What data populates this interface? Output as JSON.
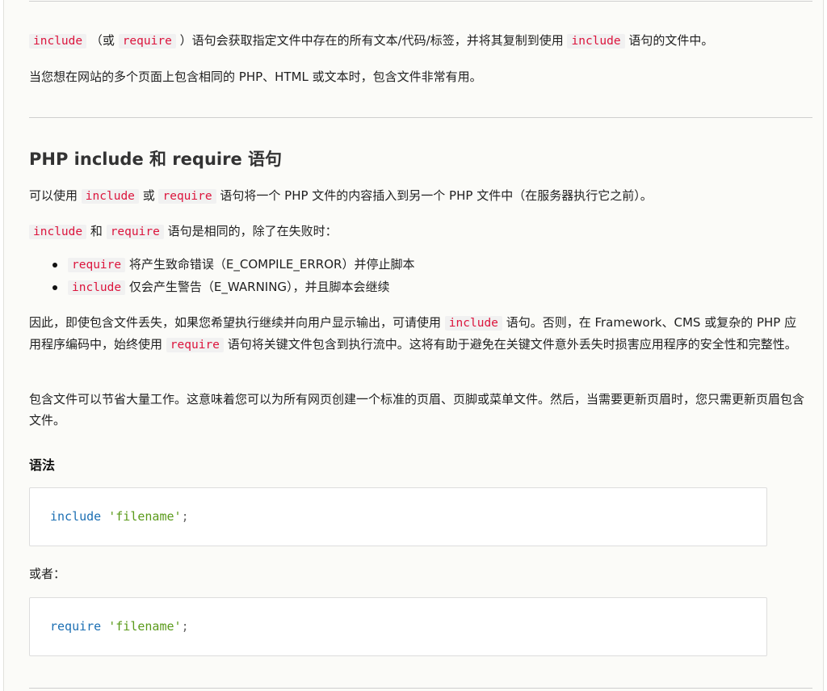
{
  "intro": {
    "p1": {
      "kw1": "include",
      "t1": "（或",
      "kw2": "require",
      "t2": "）语句会获取指定文件中存在的所有文本/代码/标签，并将其复制到使用",
      "kw3": "include",
      "t3": "语句的文件中。"
    },
    "p2": "当您想在网站的多个页面上包含相同的 PHP、HTML 或文本时，包含文件非常有用。"
  },
  "section": {
    "heading": "PHP include 和 require 语句",
    "p1": {
      "t1": "可以使用",
      "kw1": "include",
      "t2": "或",
      "kw2": "require",
      "t3": "语句将一个 PHP 文件的内容插入到另一个 PHP 文件中（在服务器执行它之前）。"
    },
    "p2": {
      "kw1": "include",
      "t1": "和",
      "kw2": "require",
      "t2": "语句是相同的，除了在失败时："
    },
    "bullets": [
      {
        "kw": "require",
        "text": "将产生致命错误（E_COMPILE_ERROR）并停止脚本"
      },
      {
        "kw": "include",
        "text": "仅会产生警告（E_WARNING），并且脚本会继续"
      }
    ],
    "p3": {
      "t1": "因此，即使包含文件丢失，如果您希望执行继续并向用户显示输出，可请使用",
      "kw1": "include",
      "t2": "语句。否则，在 Framework、CMS 或复杂的 PHP 应用程序编码中，始终使用",
      "kw2": "require",
      "t3": "语句将关键文件包含到执行流中。这将有助于避免在关键文件意外丢失时损害应用程序的安全性和完整性。"
    },
    "p4": "包含文件可以节省大量工作。这意味着您可以为所有网页创建一个标准的页眉、页脚或菜单文件。然后，当需要更新页眉时，您只需更新页眉包含文件。"
  },
  "syntax": {
    "heading": "语法",
    "code1": {
      "keyword": "include",
      "string": "'filename'",
      "end": ";"
    },
    "or_label": "或者：",
    "code2": {
      "keyword": "require",
      "string": "'filename'",
      "end": ";"
    }
  }
}
